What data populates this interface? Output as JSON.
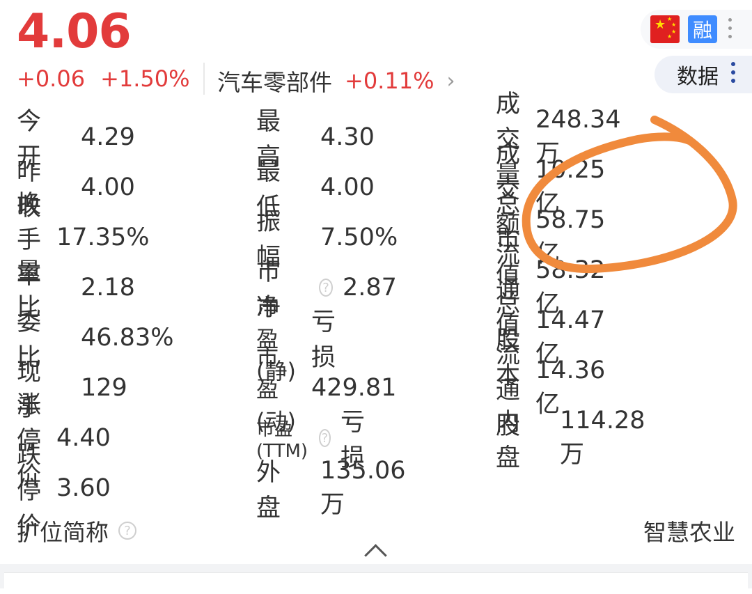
{
  "quote": {
    "price": "4.06",
    "change": "+0.06",
    "change_pct": "+1.50%",
    "sector_name": "汽车零部件",
    "sector_pct": "+0.11%",
    "sector_chevron": "›"
  },
  "badges": {
    "rong": "融",
    "data_button": "数据"
  },
  "colors": {
    "up": "#e23b3b",
    "flag": "#e02020",
    "rong": "#3f8cff",
    "annotation": "#f08a3c"
  },
  "icons": [
    "china-flag-icon",
    "rong-margin-icon",
    "more-vertical-icon",
    "help-circle-icon",
    "chevron-up-icon"
  ],
  "stats": {
    "col1": [
      {
        "label": "今　开",
        "value": "4.29"
      },
      {
        "label": "昨　收",
        "value": "4.00"
      },
      {
        "label": "换手率",
        "value": "17.35%"
      },
      {
        "label": "量　比",
        "value": "2.18"
      },
      {
        "label": "委　比",
        "value": "46.83%"
      },
      {
        "label": "现　手",
        "value": "129"
      },
      {
        "label": "涨停价",
        "value": "4.40"
      },
      {
        "label": "跌停价",
        "value": "3.60"
      }
    ],
    "col2": [
      {
        "label": "最　高",
        "value": "4.30"
      },
      {
        "label": "最　低",
        "value": "4.00"
      },
      {
        "label": "振　幅",
        "value": "7.50%"
      },
      {
        "label": "市　净",
        "value": "2.87"
      },
      {
        "label": "市盈(静)",
        "value": "亏损"
      },
      {
        "label": "市盈(动)",
        "value": "429.81"
      },
      {
        "label": "市盈(TTM)",
        "value": "亏损"
      },
      {
        "label": "外　盘",
        "value": "135.06万"
      }
    ],
    "col3": [
      {
        "label": "成交量",
        "value": "248.34万"
      },
      {
        "label": "成交额",
        "value": "10.25亿"
      },
      {
        "label": "总市值",
        "value": "58.75亿"
      },
      {
        "label": "流通值",
        "value": "58.32亿"
      },
      {
        "label": "总股本",
        "value": "14.47亿"
      },
      {
        "label": "流通股",
        "value": "14.36亿"
      },
      {
        "label": "内　盘",
        "value": "114.28万"
      }
    ]
  },
  "footer": {
    "left_label": "扩位简称",
    "right_value": "智慧农业"
  }
}
